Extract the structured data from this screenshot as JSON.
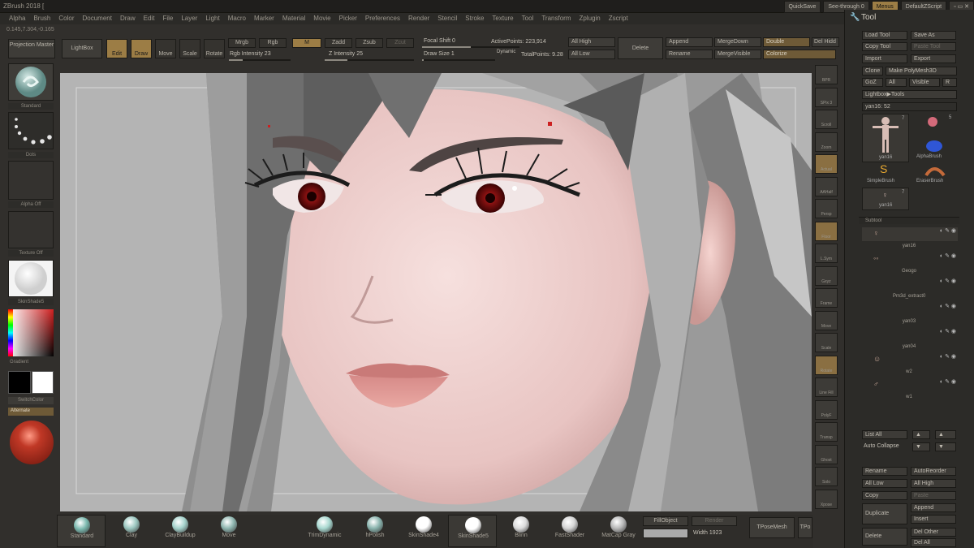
{
  "window": {
    "title": "ZBrush 2018 [",
    "quicksave": "QuickSave",
    "see_through": "See-through 0",
    "menus": "Menus",
    "default_script": "DefaultZScript"
  },
  "menubar": [
    "Alpha",
    "Brush",
    "Color",
    "Document",
    "Draw",
    "Edit",
    "File",
    "Layer",
    "Light",
    "Macro",
    "Marker",
    "Material",
    "Movie",
    "Picker",
    "Preferences",
    "Render",
    "Stencil",
    "Stroke",
    "Texture",
    "Tool",
    "Transform",
    "Zplugin",
    "Zscript"
  ],
  "coords": "0.145,7.304,-0.165",
  "toolbar": {
    "projection_master": "Projection Master",
    "lightbox": "LightBox",
    "edit": "Edit",
    "draw": "Draw",
    "move": "Move",
    "scale": "Scale",
    "rotate": "Rotate",
    "mrgb": "Mrgb",
    "rgb": "Rgb",
    "m": "M",
    "zadd": "Zadd",
    "zsub": "Zsub",
    "zcut": "Zcut",
    "rgb_intensity": "Rgb Intensity 23",
    "z_intensity": "Z Intensity 25",
    "focal_shift": "Focal Shift 0",
    "draw_size": "Draw Size 1",
    "dynamic": "Dynamic",
    "active_points": "ActivePoints: 223,914",
    "total_points": "TotalPoints: 9.28",
    "all_high": "All High",
    "all_low": "All Low",
    "delete": "Delete",
    "append": "Append",
    "rename": "Rename",
    "merge_down": "MergeDown",
    "merge_visible": "MergeVisible",
    "double": "Double",
    "colorize": "Colorize",
    "del_hidden": "Del Hidd"
  },
  "leftshelf": {
    "standard": "Standard",
    "dots": "Dots",
    "alpha_off": "Alpha Off",
    "texture_off": "Texture Off",
    "skinshade": "SkinShade5",
    "gradient": "Gradient",
    "switch_color": "SwitchColor",
    "alternate": "Alternate"
  },
  "rightshelf": [
    "BPR",
    "SPix 3",
    "Scroll",
    "Zoom",
    "Actual",
    "AAHalf",
    "Persp",
    "Floor",
    "L.Sym",
    "Gxyz",
    "Frame",
    "Move",
    "Scale",
    "Rotate",
    "Line Fill",
    "PolyF",
    "Transp",
    "Ghost",
    "Solo",
    "Xpose"
  ],
  "materials": [
    "Standard",
    "Clay",
    "ClayBuildup",
    "Move",
    "TrimDynamic",
    "hPolish",
    "SkinShade4",
    "SkinShade5",
    "Blinn",
    "FastShader",
    "MatCap Gray"
  ],
  "bottom": {
    "fill_object": "FillObject",
    "render": "Render",
    "width": "Width 1923",
    "tpose": "TPoseMesh",
    "tpo": "TPo"
  },
  "toolpanel": {
    "title": "Tool",
    "load_tool": "Load Tool",
    "save_as": "Save As",
    "copy_tool": "Copy Tool",
    "paste_tool": "Paste Tool",
    "import": "Import",
    "export": "Export",
    "clone": "Clone",
    "make_polymesh": "Make PolyMesh3D",
    "goz": "GoZ",
    "all": "All",
    "visible": "Visible",
    "r": "R",
    "lightbox_tools": "Lightbox▶Tools",
    "current": "yan16: 52",
    "thumb1": "yan16",
    "thumb2": "AlphaBrush",
    "thumb3": "SimpleBrush",
    "thumb4": "EraserBrush",
    "thumb5": "yan16",
    "n7": "7",
    "n5": "5",
    "subtool": "Subtool",
    "subtools": [
      "yan16",
      "Geogo",
      "Pm3d_extract0",
      "yan03",
      "yan04",
      "w2",
      "w1"
    ],
    "list_all": "List All",
    "auto_collapse": "Auto Collapse",
    "rename": "Rename",
    "auto_reorder": "AutoReorder",
    "all_low": "All Low",
    "all_high": "All High",
    "copy": "Copy",
    "paste": "Paste",
    "duplicate": "Duplicate",
    "append": "Append",
    "insert": "Insert",
    "delete": "Delete",
    "del_other": "Del Other",
    "del_all": "Del All"
  }
}
